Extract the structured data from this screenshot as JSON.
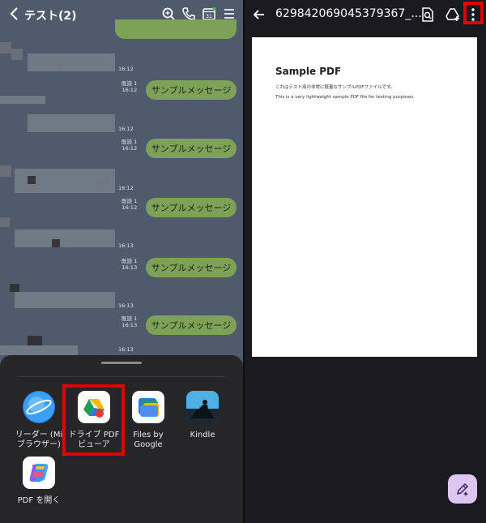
{
  "chat": {
    "title": "テスト(2)",
    "messages": [
      {
        "text": "サンプルメッセージ",
        "read": "既読 1",
        "time": "16:12"
      },
      {
        "text": "サンプルメッセージ",
        "read": "既読 1",
        "time": "16:12"
      },
      {
        "text": "サンプルメッセージ",
        "read": "既読 1",
        "time": "16:12"
      },
      {
        "text": "サンプルメッセージ",
        "read": "既読 1",
        "time": "16:13"
      },
      {
        "text": "サンプルメッセージ",
        "read": "既読 1",
        "time": "16:13"
      }
    ],
    "left_times": [
      "16:12",
      "16:12",
      "16:12",
      "16:13",
      "16:13",
      "16:13"
    ]
  },
  "share_sheet": {
    "apps": [
      {
        "label": "リーダー (Mi\nブラウザー)",
        "icon": "browser-icon"
      },
      {
        "label": "ドライブ PDF\nビューア",
        "icon": "drive-pdf-viewer-icon"
      },
      {
        "label": "Files by\nGoogle",
        "icon": "files-icon"
      },
      {
        "label": "Kindle",
        "icon": "kindle-icon"
      },
      {
        "label": "PDF を開く",
        "icon": "copilot-icon"
      }
    ]
  },
  "viewer": {
    "title": "629842069045379367_...",
    "doc_heading": "Sample PDF",
    "doc_line1": "これはテスト用の非常に軽量なサンプルPDFファイルです。",
    "doc_line2": "This is a very lightweight sample PDF file for testing purposes."
  },
  "colors": {
    "highlight": "#e10000",
    "bubble": "#7ea158",
    "chat_bg": "#4f5b6d"
  }
}
